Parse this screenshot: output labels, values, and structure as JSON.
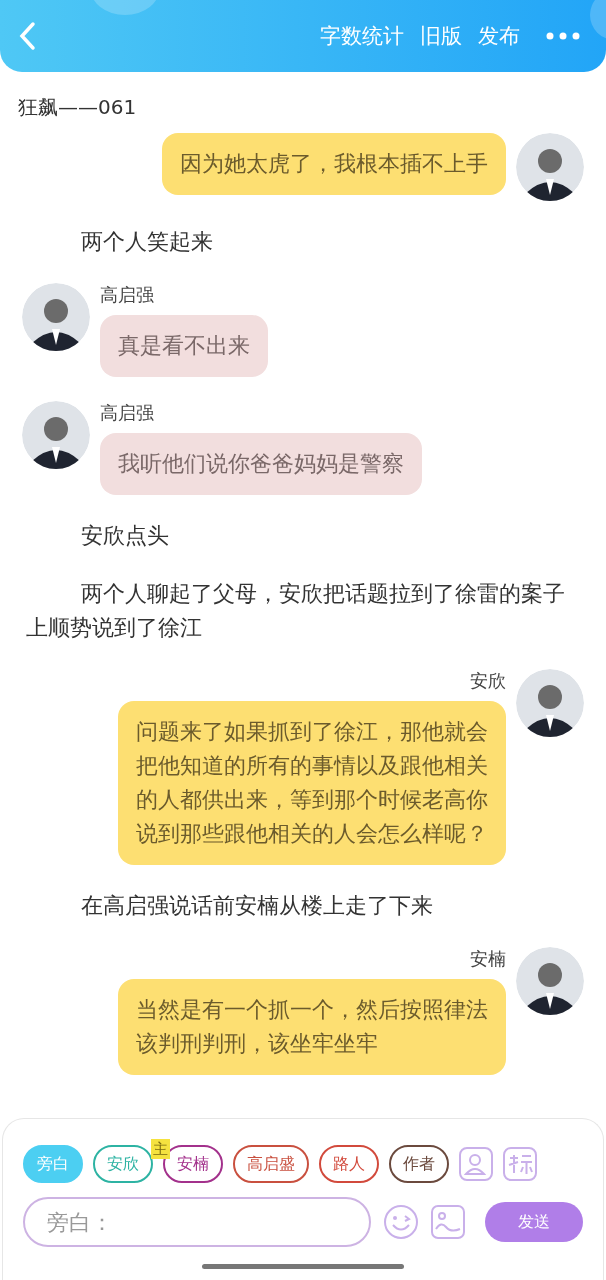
{
  "header": {
    "actions": [
      "字数统计",
      "旧版",
      "发布"
    ]
  },
  "chapter_title": "狂飙——061",
  "messages": [
    {
      "kind": "right",
      "text": "因为她太虎了，我根本插不上手"
    },
    {
      "kind": "narration",
      "text": "两个人笑起来"
    },
    {
      "kind": "left",
      "name": "高启强",
      "text": "真是看不出来"
    },
    {
      "kind": "left",
      "name": "高启强",
      "text": "我听他们说你爸爸妈妈是警察"
    },
    {
      "kind": "narration",
      "text": "安欣点头"
    },
    {
      "kind": "narration",
      "text": "两个人聊起了父母，安欣把话题拉到了徐雷的案子上顺势说到了徐江"
    },
    {
      "kind": "right",
      "name": "安欣",
      "text": "问题来了如果抓到了徐江，那他就会把他知道的所有的事情以及跟他相关的人都供出来，等到那个时候老高你说到那些跟他相关的人会怎么样呢？"
    },
    {
      "kind": "narration",
      "text": "在高启强说话前安楠从楼上走了下来"
    },
    {
      "kind": "right",
      "name": "安楠",
      "text": "当然是有一个抓一个，然后按照律法该判刑判刑，该坐牢坐牢"
    }
  ],
  "roles": [
    {
      "label": "旁白",
      "color": "#4ccff2",
      "selected": true
    },
    {
      "label": "安欣",
      "color": "#2db3a3",
      "selected": false
    },
    {
      "label": "安楠",
      "color": "#a3318c",
      "selected": false,
      "badge": "主"
    },
    {
      "label": "高启盛",
      "color": "#c9503f",
      "selected": false
    },
    {
      "label": "路人",
      "color": "#d24a3c",
      "selected": false
    },
    {
      "label": "作者",
      "color": "#6b4a3e",
      "selected": false
    }
  ],
  "composer": {
    "placeholder": "旁白：",
    "send": "发送"
  }
}
